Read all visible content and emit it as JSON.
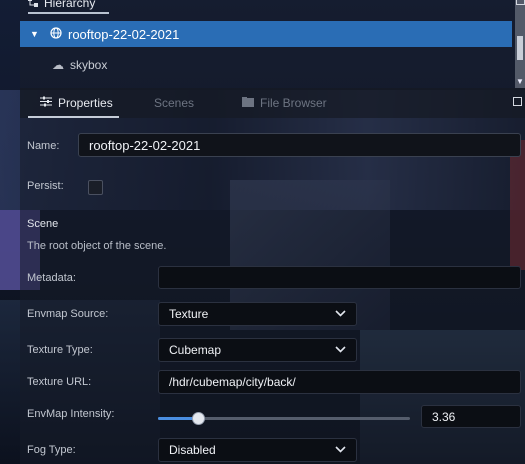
{
  "hierarchy": {
    "tab_label": "Hierarchy",
    "root_item": "rooftop-22-02-2021",
    "child_item": "skybox"
  },
  "properties": {
    "tabs": {
      "properties": "Properties",
      "scenes": "Scenes",
      "file_browser": "File Browser"
    },
    "name_label": "Name:",
    "name_value": "rooftop-22-02-2021",
    "persist_label": "Persist:",
    "persist_checked": false,
    "section_title": "Scene",
    "section_desc": "The root object of the scene.",
    "metadata_label": "Metadata:",
    "metadata_value": "",
    "envmap_source_label": "Envmap Source:",
    "envmap_source_value": "Texture",
    "texture_type_label": "Texture Type:",
    "texture_type_value": "Cubemap",
    "texture_url_label": "Texture URL:",
    "texture_url_value": "/hdr/cubemap/city/back/",
    "envmap_intensity_label": "EnvMap Intensity:",
    "envmap_intensity_value": "3.36",
    "envmap_intensity_fraction": 0.16,
    "fog_type_label": "Fog Type:",
    "fog_type_value": "Disabled"
  },
  "colors": {
    "selection": "#2a6db5",
    "slider_fill": "#4a8ee0"
  }
}
